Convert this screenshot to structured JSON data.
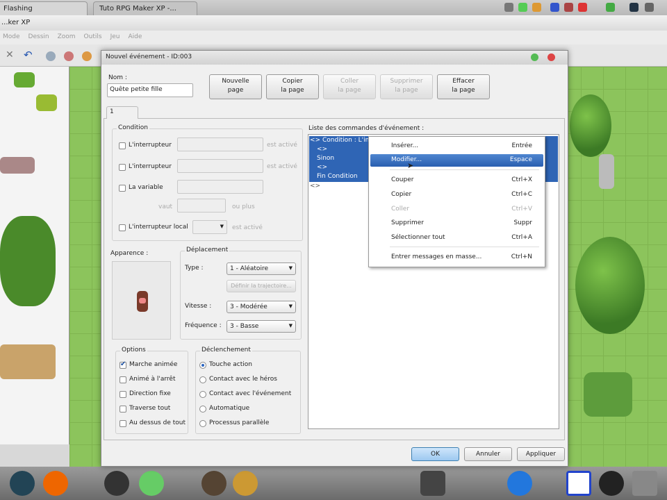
{
  "browser_tabs": [
    {
      "label": "Flashing"
    },
    {
      "label": "Tuto RPG Maker XP -..."
    }
  ],
  "app": {
    "title": "...ker XP",
    "menu": [
      "Mode",
      "Dessin",
      "Zoom",
      "Outils",
      "Jeu",
      "Aide"
    ]
  },
  "dialog": {
    "title": "Nouvel événement - ID:003",
    "name_label": "Nom :",
    "name_value": "Quête petite fille",
    "page_buttons": [
      {
        "line1": "Nouvelle",
        "line2": "page",
        "enabled": true
      },
      {
        "line1": "Copier",
        "line2": "la page",
        "enabled": true
      },
      {
        "line1": "Coller",
        "line2": "la page",
        "enabled": false
      },
      {
        "line1": "Supprimer",
        "line2": "la page",
        "enabled": false
      },
      {
        "line1": "Effacer",
        "line2": "la page",
        "enabled": true
      }
    ],
    "page_tab": "1",
    "condition": {
      "title": "Condition",
      "switch1": "L'interrupteur",
      "switch1_suffix": "est activé",
      "switch2": "L'interrupteur",
      "switch2_suffix": "est activé",
      "variable": "La variable",
      "vaut": "vaut",
      "ou_plus": "ou plus",
      "local_switch": "L'interrupteur local",
      "local_suffix": "est activé"
    },
    "appearance_label": "Apparence :",
    "movement": {
      "title": "Déplacement",
      "type_label": "Type :",
      "type_value": "1 - Aléatoire",
      "route_button": "Définir la trajectoire...",
      "speed_label": "Vitesse :",
      "speed_value": "3 - Modérée",
      "freq_label": "Fréquence :",
      "freq_value": "3 - Basse"
    },
    "options": {
      "title": "Options",
      "items": [
        {
          "label": "Marche animée",
          "checked": true
        },
        {
          "label": "Animé à l'arrêt",
          "checked": false
        },
        {
          "label": "Direction fixe",
          "checked": false
        },
        {
          "label": "Traverse tout",
          "checked": false
        },
        {
          "label": "Au dessus de tout",
          "checked": false
        }
      ]
    },
    "trigger": {
      "title": "Déclenchement",
      "items": [
        {
          "label": "Touche action",
          "selected": true
        },
        {
          "label": "Contact avec le héros",
          "selected": false
        },
        {
          "label": "Contact avec l'événement",
          "selected": false
        },
        {
          "label": "Automatique",
          "selected": false
        },
        {
          "label": "Processus parallèle",
          "selected": false
        }
      ]
    },
    "commands": {
      "label": "Liste des commandes d'événement :",
      "rows": [
        "<> Condition : L'inte...",
        "  <>",
        "  Sinon",
        "  <>",
        "  Fin Condition",
        "<>"
      ]
    },
    "context_menu": [
      {
        "label": "Insérer...",
        "shortcut": "Entrée",
        "enabled": true
      },
      {
        "label": "Modifier...",
        "shortcut": "Espace",
        "enabled": true,
        "highlighted": true
      },
      {
        "label": "Couper",
        "shortcut": "Ctrl+X",
        "enabled": true
      },
      {
        "label": "Copier",
        "shortcut": "Ctrl+C",
        "enabled": true
      },
      {
        "label": "Coller",
        "shortcut": "Ctrl+V",
        "enabled": false
      },
      {
        "label": "Supprimer",
        "shortcut": "Suppr",
        "enabled": true
      },
      {
        "label": "Sélectionner tout",
        "shortcut": "Ctrl+A",
        "enabled": true
      },
      {
        "label": "Entrer messages en masse...",
        "shortcut": "Ctrl+N",
        "enabled": true
      }
    ],
    "ok": "OK",
    "cancel": "Annuler",
    "apply": "Appliquer"
  },
  "colors": {
    "selection": "#2f65b5",
    "map_grass": "#8cc45c"
  }
}
